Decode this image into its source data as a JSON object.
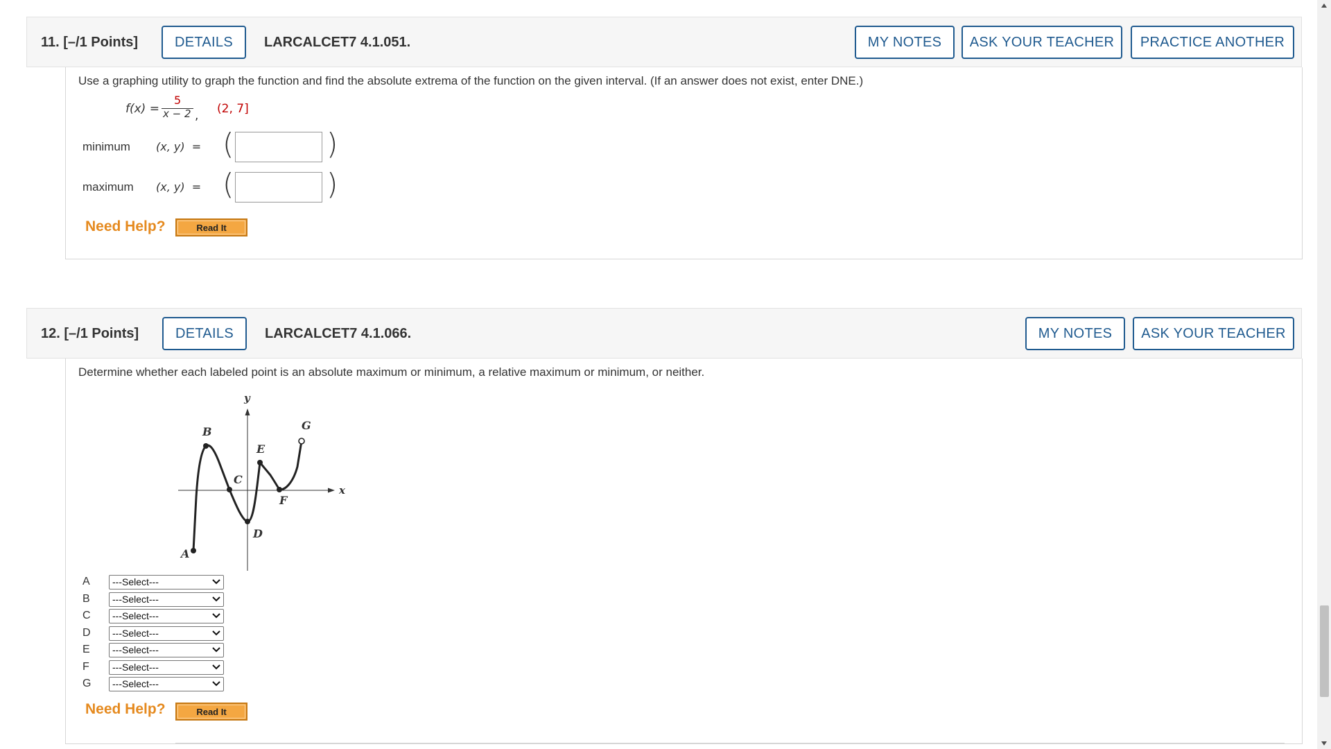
{
  "q11": {
    "number": "11.  [–/1 Points]",
    "details": "DETAILS",
    "code": "LARCALCET7 4.1.051.",
    "my_notes": "MY NOTES",
    "ask_teacher": "ASK YOUR TEACHER",
    "practice": "PRACTICE ANOTHER",
    "prompt": "Use a graphing utility to graph the function and find the absolute extrema of the function on the given interval. (If an answer does not exist, enter DNE.)",
    "fx_label": "f(x) = ",
    "numerator": "5",
    "denominator": "x − 2",
    "interval": "(2, 7]",
    "min_label": "minimum",
    "max_label": "maximum",
    "xy_label": "(x, y)",
    "min_value": "",
    "max_value": "",
    "need_help": "Need Help?",
    "read_it": "Read It"
  },
  "q12": {
    "number": "12.  [–/1 Points]",
    "details": "DETAILS",
    "code": "LARCALCET7 4.1.066.",
    "my_notes": "MY NOTES",
    "ask_teacher": "ASK YOUR TEACHER",
    "prompt": "Determine whether each labeled point is an absolute maximum or minimum, a relative maximum or minimum, or neither.",
    "graph": {
      "axis_x": "x",
      "axis_y": "y",
      "points": [
        "A",
        "B",
        "C",
        "D",
        "E",
        "F",
        "G"
      ]
    },
    "selects": [
      {
        "letter": "A",
        "value": "---Select---"
      },
      {
        "letter": "B",
        "value": "---Select---"
      },
      {
        "letter": "C",
        "value": "---Select---"
      },
      {
        "letter": "D",
        "value": "---Select---"
      },
      {
        "letter": "E",
        "value": "---Select---"
      },
      {
        "letter": "F",
        "value": "---Select---"
      },
      {
        "letter": "G",
        "value": "---Select---"
      }
    ],
    "need_help": "Need Help?",
    "read_it": "Read It"
  }
}
